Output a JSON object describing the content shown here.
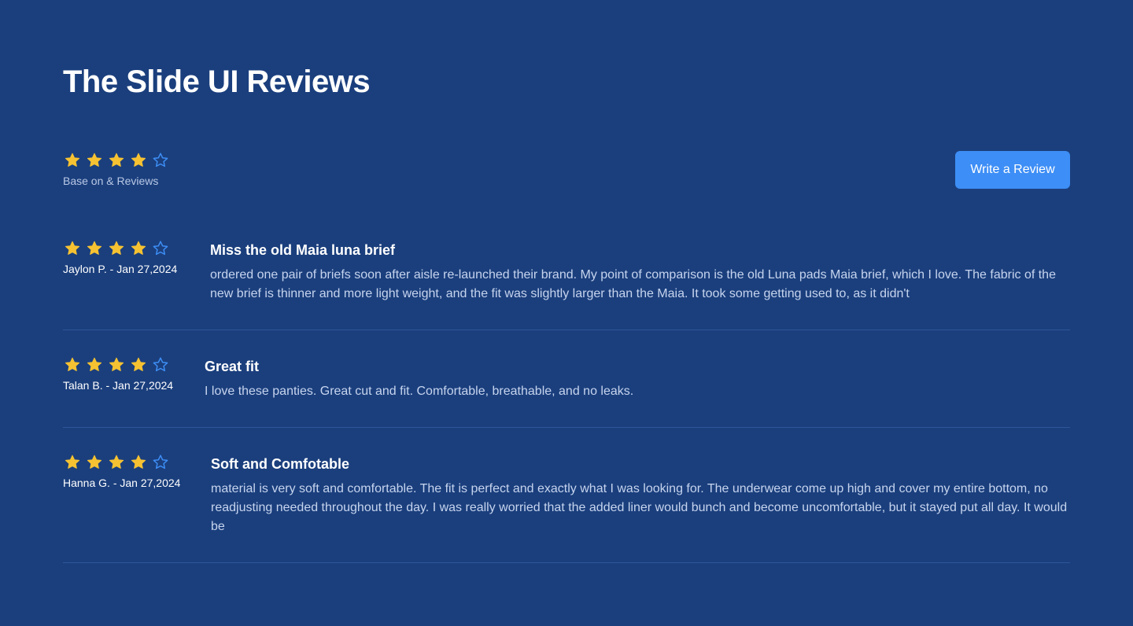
{
  "page": {
    "title": "The Slide UI Reviews"
  },
  "summary": {
    "rating": 4,
    "max_rating": 5,
    "caption": "Base on & Reviews"
  },
  "actions": {
    "write_review_label": "Write a Review"
  },
  "colors": {
    "background": "#1b3f7d",
    "star_filled": "#f6c232",
    "star_empty_outline": "#3d8ef6",
    "button": "#3d8ef6",
    "divider": "#2d569a"
  },
  "reviews": [
    {
      "rating": 4,
      "reviewer": "Jaylon P. - Jan 27,2024",
      "title": "Miss the old Maia luna brief",
      "text": "ordered one pair of briefs soon after aisle re-launched their brand. My point of comparison is the old Luna pads Maia brief, which I love. The fabric of the new brief is thinner and more light weight, and the fit was slightly larger than the Maia. It took some getting used to, as it didn't"
    },
    {
      "rating": 4,
      "reviewer": "Talan B. - Jan 27,2024",
      "title": "Great fit",
      "text": "I love these panties. Great cut and fit. Comfortable, breathable, and no leaks."
    },
    {
      "rating": 4,
      "reviewer": "Hanna G. - Jan 27,2024",
      "title": "Soft and Comfotable",
      "text": "material is very soft and comfortable. The fit is perfect and exactly what I was looking for. The underwear come up high and cover my entire bottom, no readjusting needed throughout the day. I was really worried that the added liner would bunch and become uncomfortable, but it stayed put all day. It would be"
    }
  ]
}
